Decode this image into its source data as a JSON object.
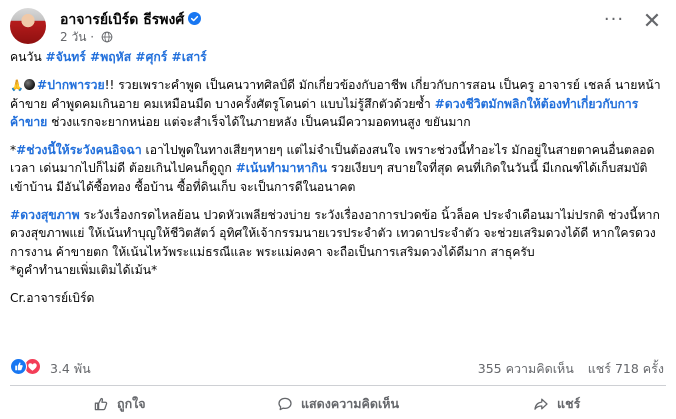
{
  "header": {
    "author": "อาจารย์เบิร์ด ธีรพงศ์",
    "time": "2 วัน",
    "separator": "·",
    "more_label": "···",
    "close_label": "✕"
  },
  "post": {
    "p1": {
      "prefix": "คนวัน ",
      "tags": "#จันทร์ #พฤหัส #ศุกร์ #เสาร์"
    },
    "p2": {
      "tag1": "#ปากพารวย",
      "text1": "!! รวยเพราะคำพูด เป็นคนวาทศิลป์ดี มักเกี่ยวข้องกับอาชีพ เกี่ยวกับการสอน เป็นครู อาจารย์ เชลล์ นายหน้า ค้าขาย คำพูดคมเกินอาย คมเหมือนมีด บางครั้งศัตรูโดนด่า แบบไม่รู้สึกตัวด้วยซ้ำ ",
      "tag2": "#ดวงชีวิตมักพลิกให้ต้องทำเกี่ยวกับการค้าขาย",
      "text2": " ช่วงแรกจะยากหน่อย แต่จะสำเร็จได้ในภายหลัง เป็นคนมีความอดทนสูง ขยันมาก"
    },
    "p3": {
      "star": "*",
      "tag1": "#ช่วงนี้ให้ระวังคนอิจฉา",
      "text1": " เอาไปพูดในทางเสียๆหายๆ แต่ไม่จำเป็นต้องสนใจ เพราะช่วงนี้ทำอะไร มักอยู่ในสายตาคนอื่นตลอดเวลา เด่นมากไปก็ไม่ดี ต้อยเกินไปคนก็ดูถูก ",
      "tag2": "#เน้นทำมาหากิน",
      "text2": " รวยเงียบๆ สบายใจที่สุด คนที่เกิดในวันนี้ มีเกณฑ์ได้เก็บสมบัติเข้าบ้าน มีอันได้ซื้อทอง ซื้อบ้าน ซื้อที่ดินเก็บ จะเป็นการดีในอนาคต"
    },
    "p4": {
      "tag1": "#ดวงสุขภาพ",
      "text1": " ระวังเรื่องกรดไหลย้อน ปวดหัวเพลียช่วงบ่าย ระวังเรื่องอาการปวดข้อ นิ้วล็อค ประจำเดือนมาไม่ปรกติ ช่วงนี้หากดวงสุขภาพแย่ ให้เน้นทำบุญให้ชีวิตสัตว์ อุทิศให้เจ้ากรรมนายเวรประจำตัว เทวดาประจำตัว จะช่วยเสริมดวงได้ดี หากใครดวงการงาน ค้าขายตก ให้เน้นไหว้พระแม่ธรณีและ พระแม่คงคา จะถือเป็นการเสริมดวงได้ดีมาก สาธุครับ",
      "text2": "*ดูคำทำนายเพิ่มเติมได้เม้น*"
    },
    "p5": "Cr.อาจารย์เบิร์ด"
  },
  "reactions": {
    "count": "3.4 พัน",
    "comments": "355 ความคิดเห็น",
    "shares": "แชร์ 718 ครั้ง"
  },
  "actions": {
    "like": "ถูกใจ",
    "comment": "แสดงความคิดเห็น",
    "share": "แชร์"
  },
  "colors": {
    "hashtag": "#216fdb",
    "like_blue": "#1877f2",
    "love_red": "#f33e58",
    "secondary_text": "#65676b"
  }
}
